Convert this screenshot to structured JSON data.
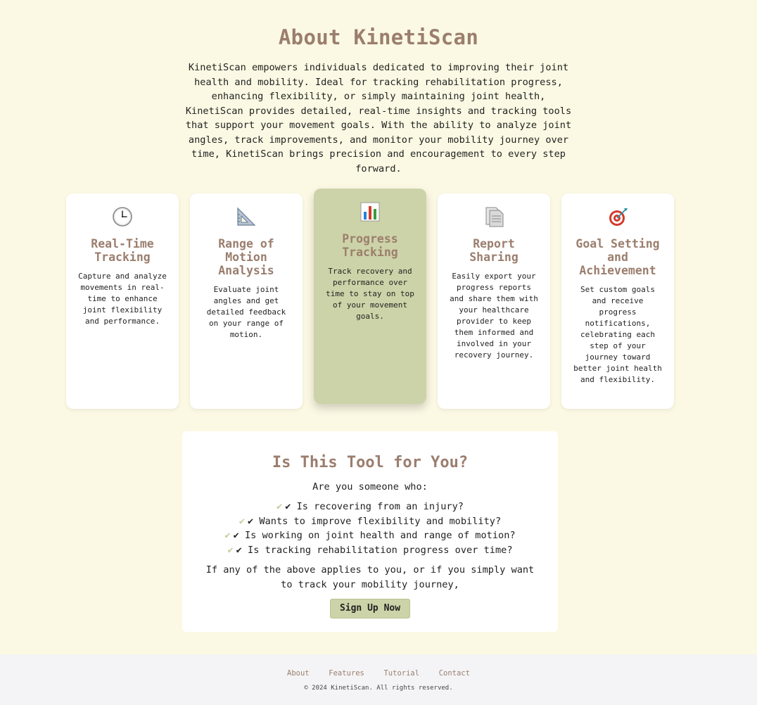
{
  "about": {
    "title": "About KinetiScan",
    "description": "KinetiScan empowers individuals dedicated to improving their joint health and mobility. Ideal for tracking rehabilitation progress, enhancing flexibility, or simply maintaining joint health, KinetiScan provides detailed, real-time insights and tracking tools that support your movement goals. With the ability to analyze joint angles, track improvements, and monitor your mobility journey over time, KinetiScan brings precision and encouragement to every step forward."
  },
  "features": [
    {
      "icon": "clock-icon",
      "title": "Real-Time Tracking",
      "text": "Capture and analyze movements in real-time to enhance joint flexibility and performance."
    },
    {
      "icon": "triangle-ruler-icon",
      "title": "Range of Motion Analysis",
      "text": "Evaluate joint angles and get detailed feedback on your range of motion."
    },
    {
      "icon": "bar-chart-icon",
      "title": "Progress Tracking",
      "text": "Track recovery and performance over time to stay on top of your movement goals.",
      "highlighted": true
    },
    {
      "icon": "document-icon",
      "title": "Report Sharing",
      "text": "Easily export your progress reports and share them with your healthcare provider to keep them informed and involved in your recovery journey."
    },
    {
      "icon": "target-icon",
      "title": "Goal Setting and Achievement",
      "text": "Set custom goals and receive progress notifications, celebrating each step of your journey toward better joint health and flexibility."
    }
  ],
  "fit": {
    "title": "Is This Tool for You?",
    "intro": "Are you someone who:",
    "check_mark": "✔",
    "items": [
      "✔ Is recovering from an injury?",
      "✔ Wants to improve flexibility and mobility?",
      "✔ Is working on joint health and range of motion?",
      "✔ Is tracking rehabilitation progress over time?"
    ],
    "outro": "If any of the above applies to you, or if you simply want to track your mobility journey,",
    "signup_label": "Sign Up Now"
  },
  "footer": {
    "links": [
      "About",
      "Features",
      "Tutorial",
      "Contact"
    ],
    "copyright": "© 2024 KinetiScan. All rights reserved."
  },
  "colors": {
    "background": "#fbf9e3",
    "heading": "#9b7e6e",
    "accent": "#cdd3a8",
    "card": "#ffffff",
    "footer_bg": "#f4f4f6"
  }
}
